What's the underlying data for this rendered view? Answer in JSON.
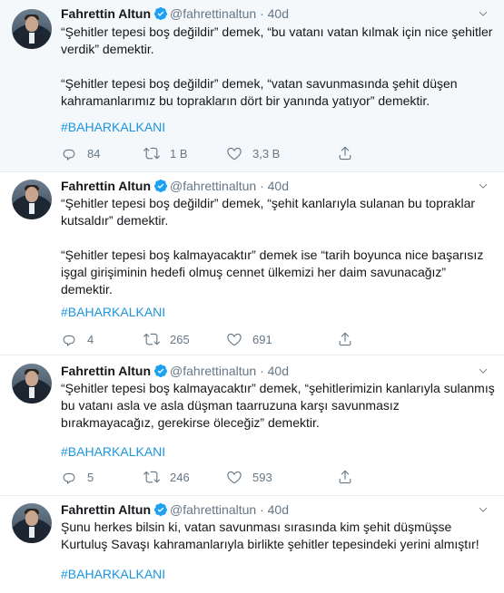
{
  "tweets": [
    {
      "name": "Fahrettin Altun",
      "handle": "@fahrettinaltun",
      "time": "40d",
      "paragraphs": [
        "“Şehitler tepesi boş değildir” demek, “bu vatanı vatan kılmak için nice şehitler verdik” demektir.",
        "“Şehitler tepesi boş değildir” demek,  “vatan savunmasında şehit düşen kahramanlarımız bu toprakların dört bir yanında yatıyor” demektir."
      ],
      "hashtag": "#BAHARKALKANI",
      "replies": "84",
      "retweets": "1 B",
      "likes": "3,3 B"
    },
    {
      "name": "Fahrettin Altun",
      "handle": "@fahrettinaltun",
      "time": "40d",
      "paragraphs": [
        "“Şehitler tepesi boş değildir” demek, “şehit kanlarıyla sulanan bu topraklar kutsaldır” demektir.",
        "“Şehitler tepesi boş kalmayacaktır” demek ise “tarih boyunca nice başarısız işgal girişiminin hedefi olmuş cennet ülkemizi her daim savunacağız” demektir."
      ],
      "hashtag": "#BAHARKALKANI",
      "replies": "4",
      "retweets": "265",
      "likes": "691"
    },
    {
      "name": "Fahrettin Altun",
      "handle": "@fahrettinaltun",
      "time": "40d",
      "paragraphs": [
        "“Şehitler tepesi boş kalmayacaktır” demek, “şehitlerimizin kanlarıyla sulanmış bu vatanı asla ve asla düşman taarruzuna karşı savunmasız bırakmayacağız, gerekirse öleceğiz” demektir."
      ],
      "hashtag": "#BAHARKALKANI",
      "replies": "5",
      "retweets": "246",
      "likes": "593"
    },
    {
      "name": "Fahrettin Altun",
      "handle": "@fahrettinaltun",
      "time": "40d",
      "paragraphs": [
        "Şunu herkes bilsin ki, vatan savunması sırasında kim şehit düşmüşse Kurtuluş Savaşı kahramanlarıyla birlikte şehitler tepesindeki yerini almıştır!"
      ],
      "hashtag": "#BAHARKALKANI"
    }
  ],
  "icons": {
    "verified": "verified-badge-icon",
    "caret": "chevron-down-icon",
    "reply": "reply-icon",
    "retweet": "retweet-icon",
    "like": "heart-icon",
    "share": "share-icon"
  },
  "colors": {
    "accent": "#1b95e0",
    "secondary_text": "#657786",
    "highlight_background": "#f5f8fa"
  }
}
